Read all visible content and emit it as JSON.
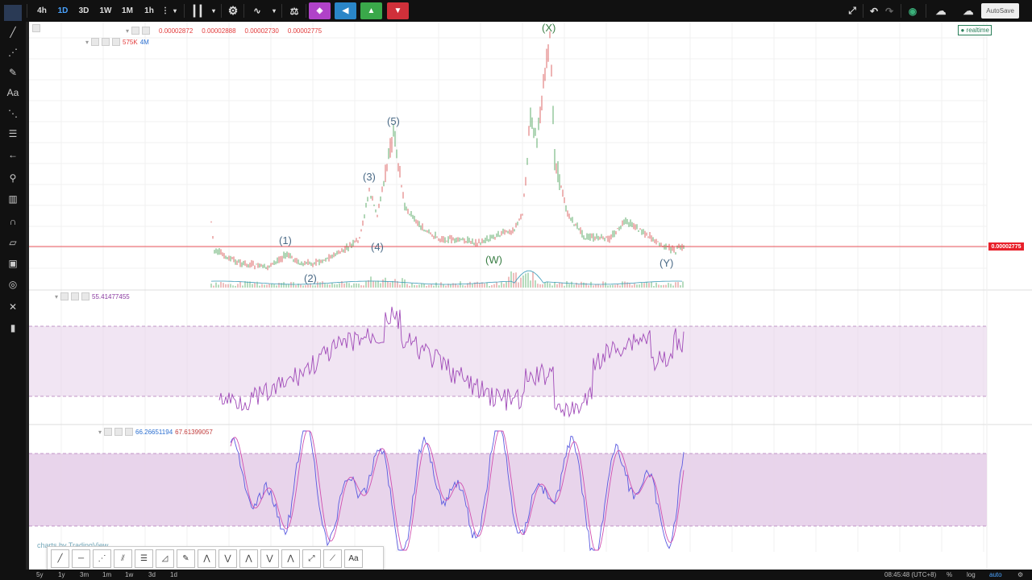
{
  "toolbar": {
    "intervals": [
      "4h",
      "1D",
      "3D",
      "1W",
      "1M",
      "1h"
    ],
    "active_interval": "1D",
    "autosave_label": "AutoSave"
  },
  "legend": {
    "main": [
      "0.00002872",
      "0.00002888",
      "0.00002730",
      "0.00002775"
    ],
    "volume": "575K",
    "volume_ma": "4M",
    "rsi": "55.41477455",
    "stoch_k": "66.26651194",
    "stoch_d": "67.61399057"
  },
  "realtime_label": "realtime",
  "last_price": "0.00002775",
  "waves": [
    "(1)",
    "(2)",
    "(3)",
    "(4)",
    "(5)",
    "(W)",
    "(X)",
    "(Y)"
  ],
  "watermark": "charts by TradingView",
  "drawing_text_tool": "Aa",
  "bottom": {
    "ranges": [
      "5y",
      "1y",
      "3m",
      "1m",
      "1w",
      "3d",
      "1d"
    ],
    "clock": "08:45:48 (UTC+8)",
    "percent": "%",
    "log": "log",
    "auto": "auto"
  },
  "colors": {
    "up": "#3a9a4a",
    "down": "#d64545",
    "price_line": "#e8202a",
    "rsi_line": "#a04ab8",
    "stoch_k": "#5a5ae0",
    "stoch_d": "#d050b0",
    "band": "#e6cfe9"
  },
  "icons": {
    "crosshair": "crosshair-icon",
    "trendline": "trendline-icon",
    "text": "text-icon",
    "zoom": "zoom-icon",
    "magnet": "magnet-icon",
    "lock": "lock-icon",
    "trash": "trash-icon"
  }
}
